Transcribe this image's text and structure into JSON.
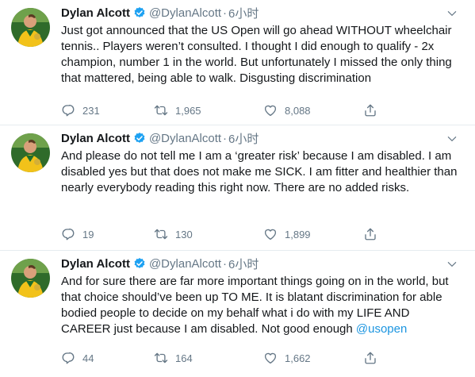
{
  "colors": {
    "text": "#14171a",
    "muted": "#657786",
    "link": "#1b95e0",
    "verified": "#1da1f2",
    "divider": "#e6ecf0"
  },
  "icons": {
    "verified": "verified-badge-icon",
    "more": "chevron-down-icon",
    "reply": "reply-icon",
    "retweet": "retweet-icon",
    "like": "like-icon",
    "share": "share-icon"
  },
  "tweets": [
    {
      "name": "Dylan Alcott",
      "handle": "@DylanAlcott",
      "separator": "·",
      "time": "6小时",
      "text": "Just got announced that the US Open will go ahead WITHOUT wheelchair tennis.. Players weren’t consulted. I thought I did enough to qualify - 2x champion, number 1 in the world. But unfortunately I missed the only thing that mattered, being able to walk. Disgusting discrimination",
      "mention": "",
      "replies": "231",
      "retweets": "1,965",
      "likes": "8,088"
    },
    {
      "name": "Dylan Alcott",
      "handle": "@DylanAlcott",
      "separator": "·",
      "time": "6小时",
      "text": "And please do not tell me I am a ‘greater risk’ because I am disabled. I am disabled yes but that does not make me SICK. I am fitter and healthier than nearly everybody reading this right now. There are no added risks.",
      "mention": "",
      "replies": "19",
      "retweets": "130",
      "likes": "1,899"
    },
    {
      "name": "Dylan Alcott",
      "handle": "@DylanAlcott",
      "separator": "·",
      "time": "6小时",
      "text": "And for sure there are far more important things going on in the world, but that choice should’ve been up TO ME. It is blatant discrimination for able bodied people to decide on my behalf what i do with my LIFE AND CAREER just because I am disabled. Not good enough ",
      "mention": "@usopen",
      "replies": "44",
      "retweets": "164",
      "likes": "1,662"
    }
  ]
}
